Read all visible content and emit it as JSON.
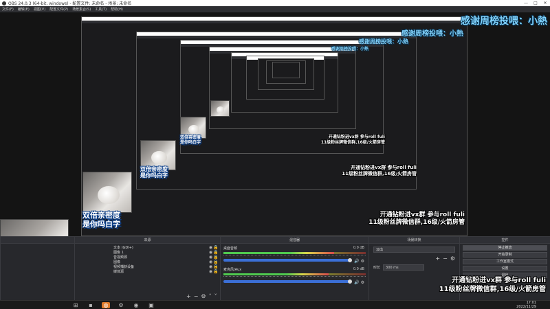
{
  "window": {
    "title": "OBS 24.0.3 (64-bit, windows) - 配置文件: 未命名 - 场景: 未命名",
    "controls": [
      "—",
      "□",
      "✕"
    ]
  },
  "menu": [
    "文件(F)",
    "编辑(E)",
    "视图(V)",
    "配置文件(P)",
    "场景集合(S)",
    "工具(T)",
    "帮助(H)"
  ],
  "overlay": {
    "danmu": [
      "感谢周榜投喂：小熱",
      "感谢周榜投喂：小熱",
      "感谢周榜投喂：小熱",
      "感谢周榜投喂：小熱"
    ],
    "promo_line1": "开通钻粉进vx群 参与roll fuli",
    "promo_line2": "11级粉丝牌微信群,16级/火箭房管",
    "badge_line1": "双倍亲密度",
    "badge_line2": "是你吗白字"
  },
  "docks": {
    "sources": {
      "title": "来源",
      "items": [
        "文本 (GDI+)",
        "图像 1",
        "音视频源",
        "图像",
        "视频捕获设备",
        "媒体源"
      ]
    },
    "mixer": {
      "title": "混音器",
      "channels": [
        {
          "name": "桌面音频",
          "db": "0.0 dB",
          "level": 0.78
        },
        {
          "name": "麦克风/Aux",
          "db": "0.0 dB",
          "level": 0.74
        }
      ]
    },
    "transitions": {
      "title": "场景转换",
      "selected": "淡出",
      "duration_label": "时长",
      "duration_value": "300 ms"
    },
    "controls": {
      "title": "控件",
      "buttons": [
        "停止推流",
        "开始录制",
        "工作室模式",
        "设置",
        "退出"
      ]
    }
  },
  "taskbar": {
    "time": "17:01",
    "date": "2022/11/29",
    "icons": [
      "windows-icon",
      "search-icon",
      "taskview-icon",
      "files-icon",
      "app-icon",
      "obs-icon",
      "settings-icon",
      "game-icon"
    ]
  }
}
